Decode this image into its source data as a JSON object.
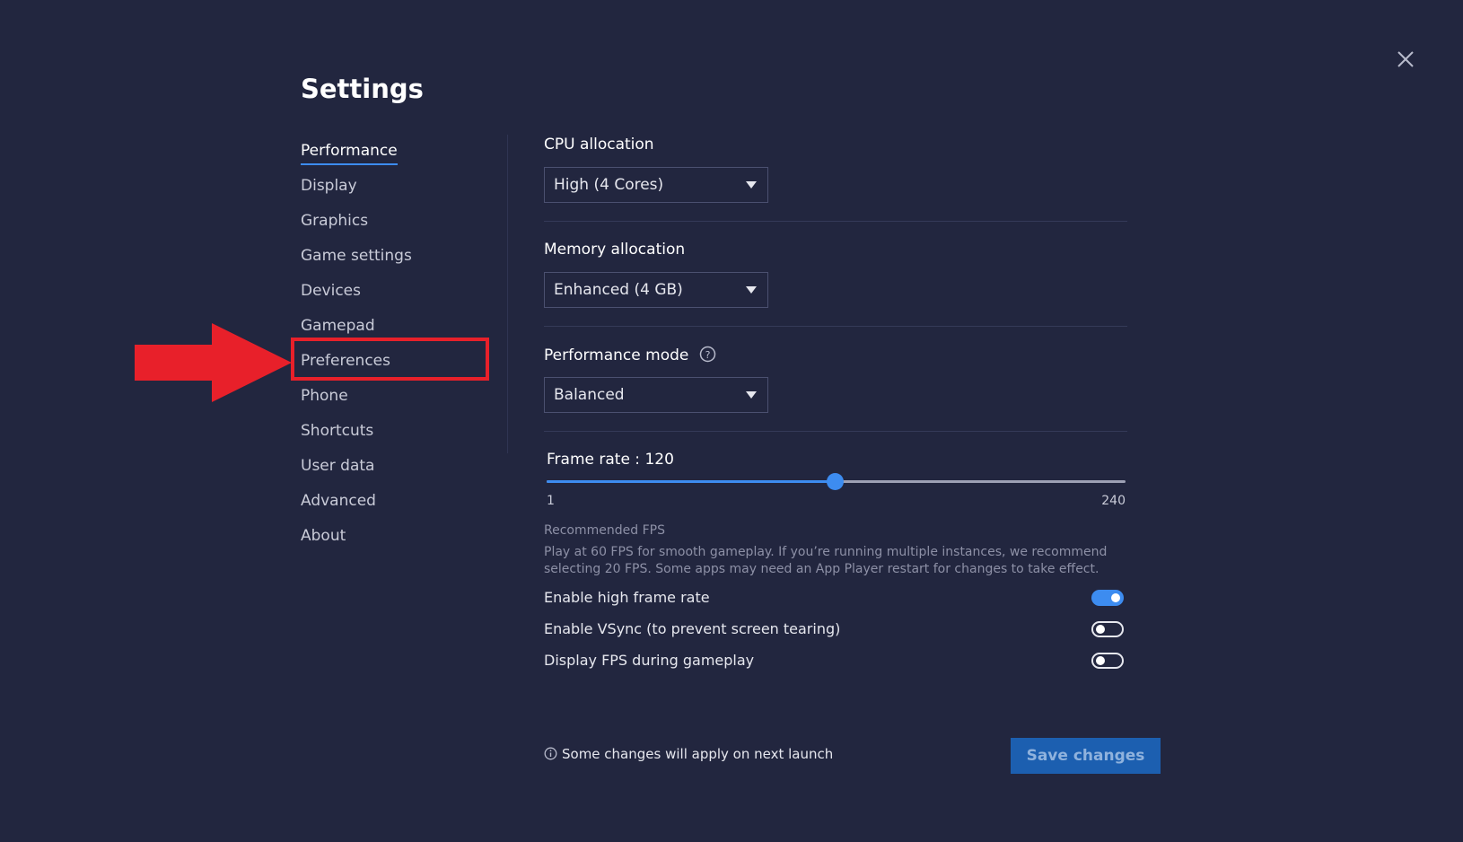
{
  "window": {
    "title": "Settings"
  },
  "colors": {
    "accent": "#3d8cf0",
    "background": "#22263f",
    "annotation": "#e8202a"
  },
  "icons": {
    "close": "close-icon",
    "help": "help-circle-icon",
    "info": "info-icon",
    "dropdown": "caret-down-icon",
    "arrow": "arrow-right-icon"
  },
  "sidebar": {
    "items": [
      {
        "label": "Performance",
        "active": true
      },
      {
        "label": "Display"
      },
      {
        "label": "Graphics"
      },
      {
        "label": "Game settings"
      },
      {
        "label": "Devices"
      },
      {
        "label": "Gamepad"
      },
      {
        "label": "Preferences",
        "highlighted": true
      },
      {
        "label": "Phone"
      },
      {
        "label": "Shortcuts"
      },
      {
        "label": "User data"
      },
      {
        "label": "Advanced"
      },
      {
        "label": "About"
      }
    ]
  },
  "performance": {
    "cpu": {
      "label": "CPU allocation",
      "value": "High (4 Cores)"
    },
    "memory": {
      "label": "Memory allocation",
      "value": "Enhanced (4 GB)"
    },
    "mode": {
      "label": "Performance mode",
      "value": "Balanced"
    },
    "frame_rate": {
      "label": "Frame rate : 120",
      "value": 120,
      "min": 1,
      "max": 240,
      "min_label": "1",
      "max_label": "240"
    },
    "recommended": {
      "title": "Recommended FPS",
      "description": "Play at 60 FPS for smooth gameplay. If you’re running multiple instances, we recommend selecting 20 FPS. Some apps may need an App Player restart for changes to take effect."
    },
    "toggles": [
      {
        "label": "Enable high frame rate",
        "on": true
      },
      {
        "label": "Enable VSync (to prevent screen tearing)",
        "on": false
      },
      {
        "label": "Display FPS during gameplay",
        "on": false
      }
    ]
  },
  "footer": {
    "note": "Some changes will apply on next launch",
    "save_label": "Save changes"
  }
}
